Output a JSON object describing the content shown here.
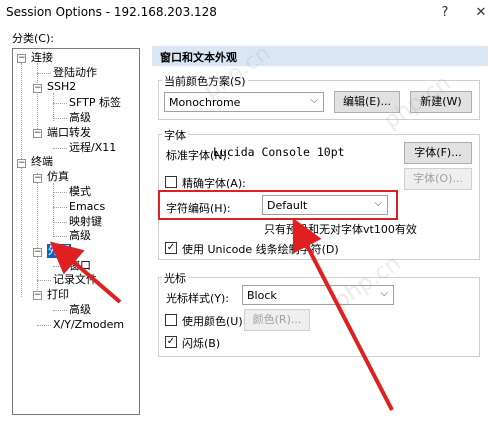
{
  "window": {
    "title": "Session Options - 192.168.203.128",
    "help": "?",
    "close": "✕"
  },
  "sidebar": {
    "category_label": "分类(C):",
    "tree": {
      "connection": "连接",
      "login_action": "登陆动作",
      "ssh2": "SSH2",
      "sftp_tab": "SFTP 标签",
      "advanced1": "高级",
      "port_forward": "端口转发",
      "remote_x11": "远程/X11",
      "terminal": "终端",
      "emulation": "仿真",
      "mode": "模式",
      "emacs": "Emacs",
      "mapping_keys": "映射键",
      "advanced2": "高级",
      "appearance": "外观",
      "window": "窗口",
      "log_file": "记录文件",
      "print": "打印",
      "advanced3": "高级",
      "xyz_modem": "X/Y/Zmodem"
    }
  },
  "panel": {
    "header": "窗口和文本外观",
    "color_scheme": {
      "label": "当前颜色方案(S)",
      "value": "Monochrome",
      "edit_button": "编辑(E)...",
      "new_button": "新建(W)"
    },
    "font": {
      "group_label": "字体",
      "standard_label": "标准字体(N):",
      "standard_value": "Lucida Console 10pt",
      "font_button": "字体(F)...",
      "precise_label": "精确字体(A):",
      "precise_font_button": "字体(O)...",
      "encoding_label": "字符编码(H):",
      "encoding_value": "Default",
      "note": "只有预设和无对字体vt100有效",
      "unicode_label": "使用 Unicode 线条绘制字符(D)"
    },
    "cursor": {
      "group_label": "光标",
      "style_label": "光标样式(Y):",
      "style_value": "Block",
      "use_color_label": "使用颜色(U):",
      "color_button": "颜色(R)...",
      "blink_label": "闪烁(B)"
    }
  },
  "colors": {
    "accent": "#0a64c8",
    "annotation": "#e02020",
    "header_bg": "#dbe6f4"
  },
  "watermark": "php.cn"
}
